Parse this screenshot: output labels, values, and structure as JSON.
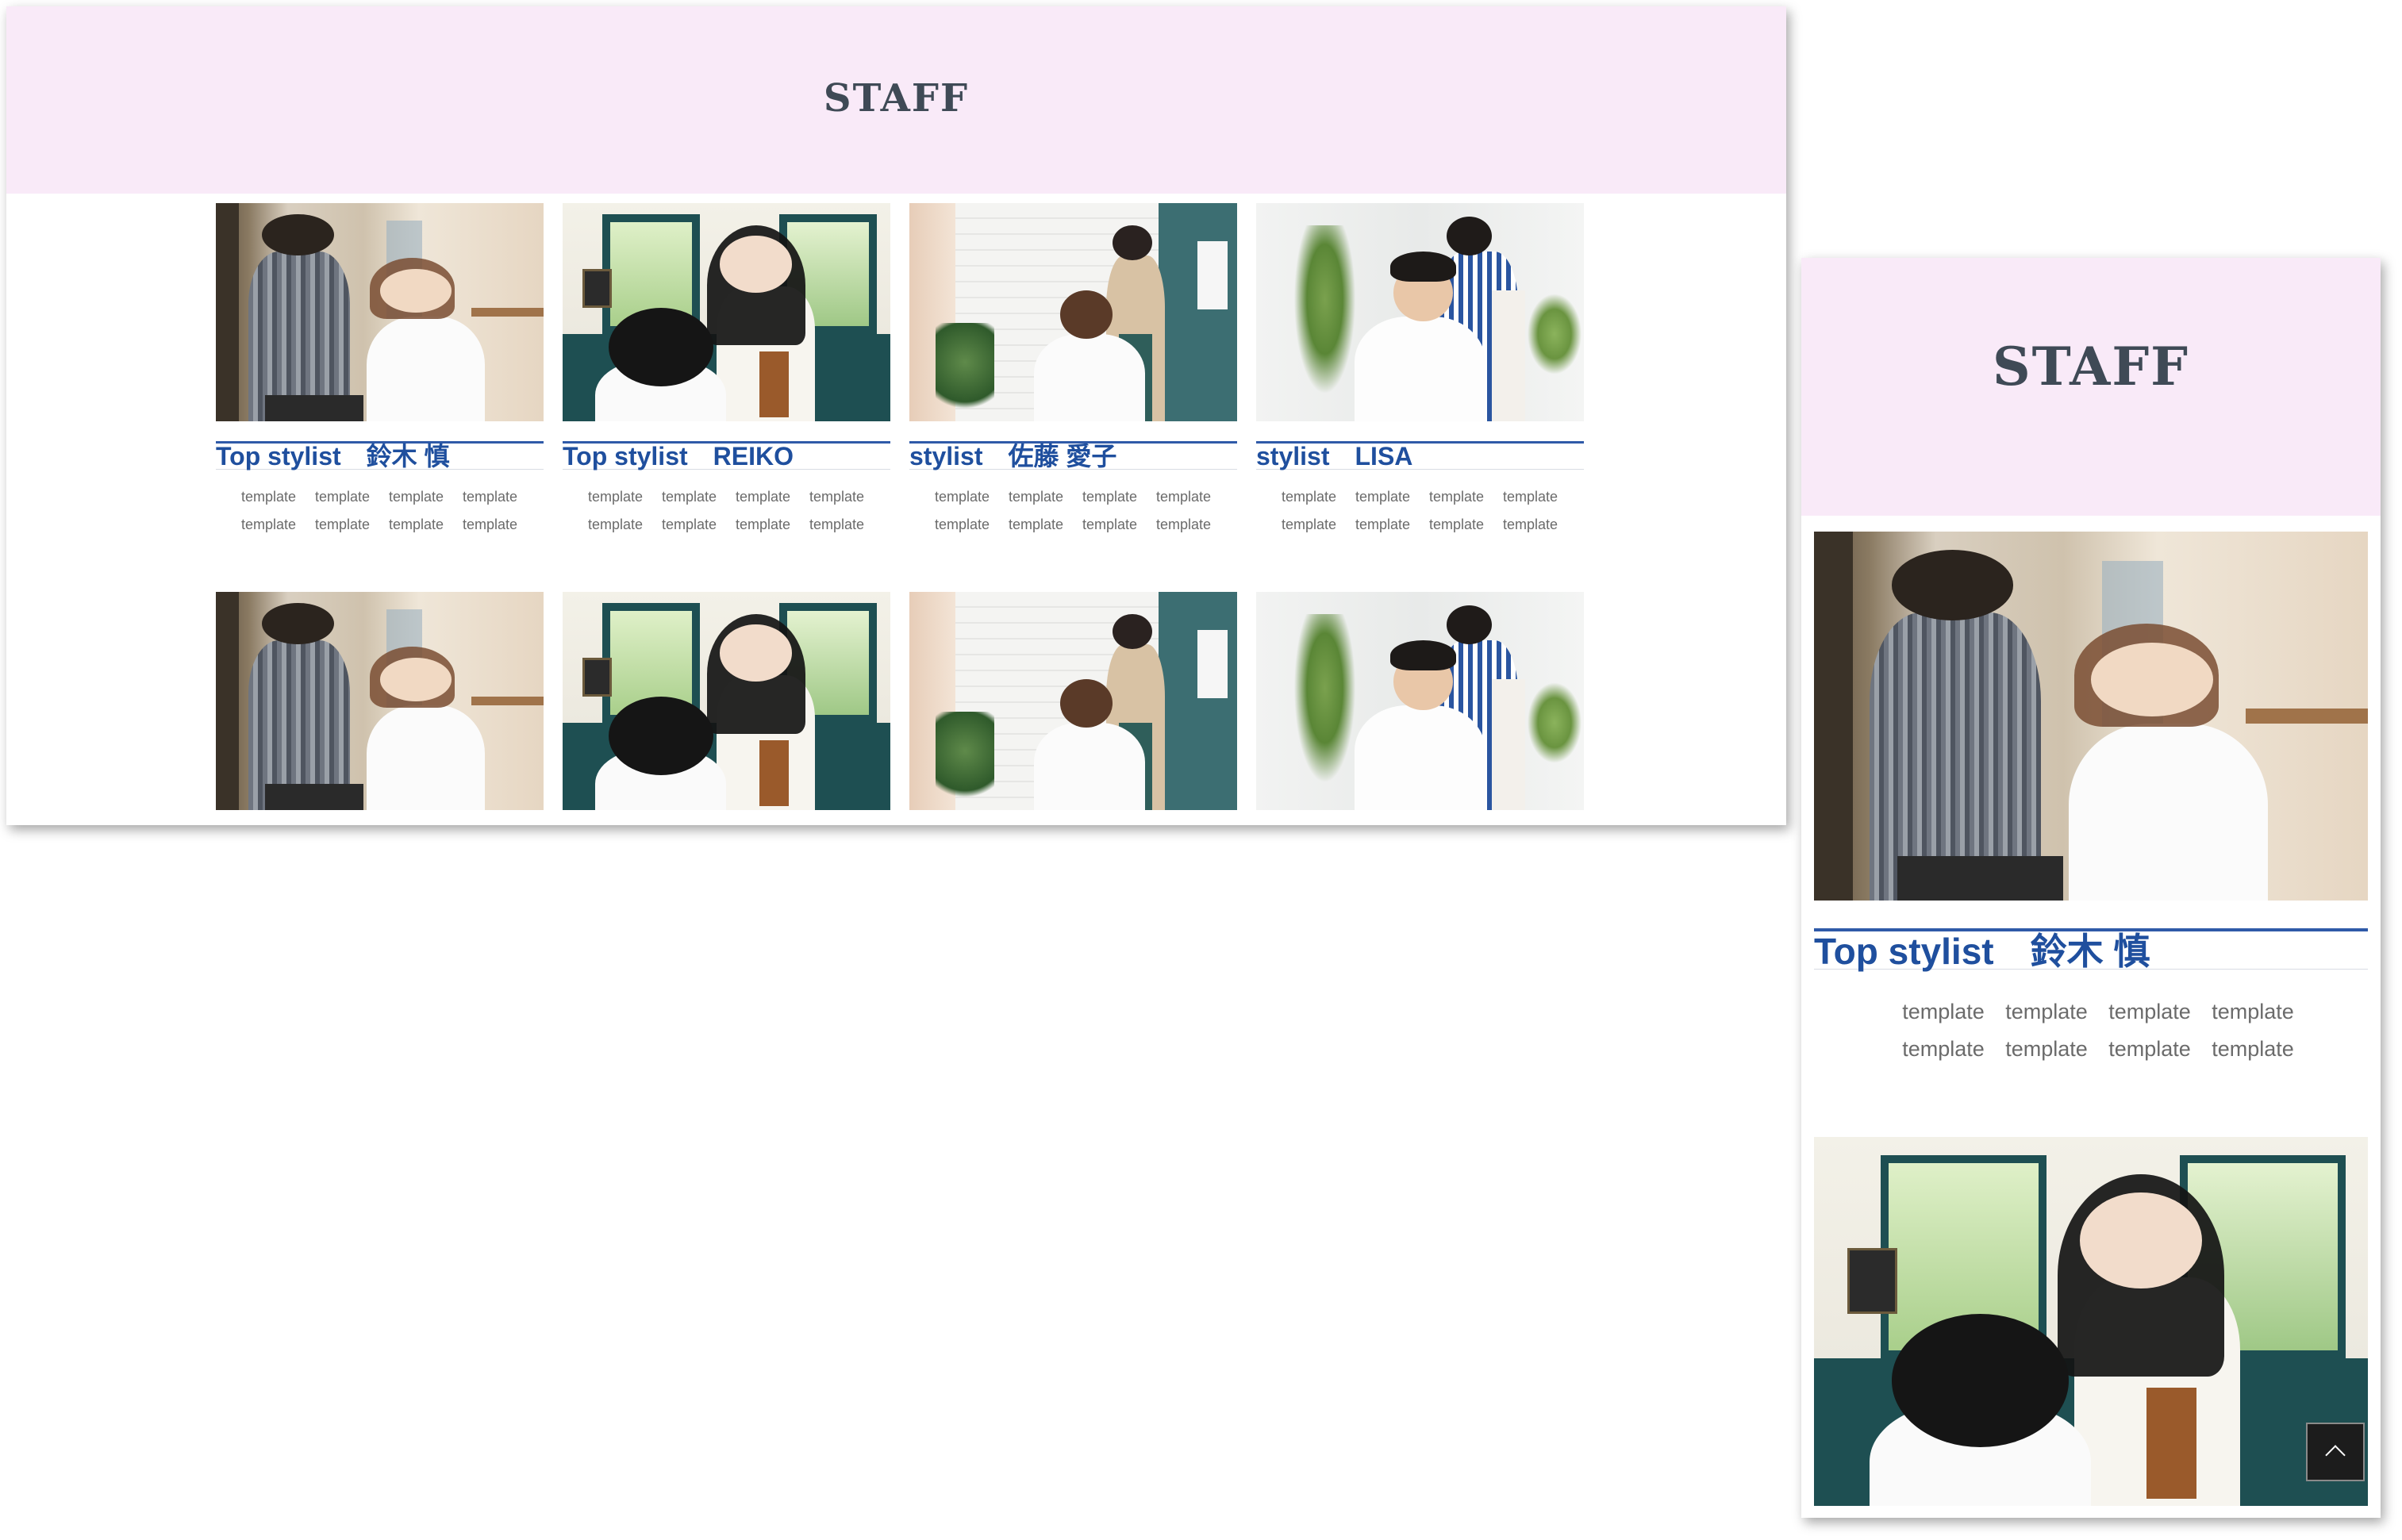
{
  "desktop": {
    "section_title": "STAFF",
    "staff": [
      {
        "role": "Top stylist",
        "name": "鈴木 慎",
        "photo": "salon-scene-man-styling",
        "tags": [
          "template",
          "template",
          "template",
          "template",
          "template",
          "template",
          "template",
          "template"
        ]
      },
      {
        "role": "Top stylist",
        "name": "REIKO",
        "photo": "salon-scene-green-windows",
        "tags": [
          "template",
          "template",
          "template",
          "template",
          "template",
          "template",
          "template",
          "template"
        ]
      },
      {
        "role": "stylist",
        "name": "佐藤 愛子",
        "photo": "salon-scene-brick-wall",
        "tags": [
          "template",
          "template",
          "template",
          "template",
          "template",
          "template",
          "template",
          "template"
        ]
      },
      {
        "role": "stylist",
        "name": "LISA",
        "photo": "salon-scene-plant",
        "tags": [
          "template",
          "template",
          "template",
          "template",
          "template",
          "template",
          "template",
          "template"
        ]
      }
    ],
    "second_row_photos": [
      "salon-scene-man-styling",
      "salon-scene-green-windows",
      "salon-scene-brick-wall",
      "salon-scene-plant"
    ]
  },
  "mobile": {
    "section_title": "STAFF",
    "staff": [
      {
        "role": "Top stylist",
        "name": "鈴木 慎",
        "photo": "salon-scene-man-styling",
        "tags": [
          "template",
          "template",
          "template",
          "template",
          "template",
          "template",
          "template",
          "template"
        ]
      }
    ],
    "next_photo": "salon-scene-green-windows",
    "back_to_top_icon": "chevron-up-icon"
  },
  "colors": {
    "hero_background": "#f9eaf8",
    "title_text": "#3f4a56",
    "staff_name": "#1f4f9e",
    "name_rule": "#2f5aa8",
    "tag_text": "#6b6b6b",
    "back_to_top_bg": "#1c1c1c"
  }
}
